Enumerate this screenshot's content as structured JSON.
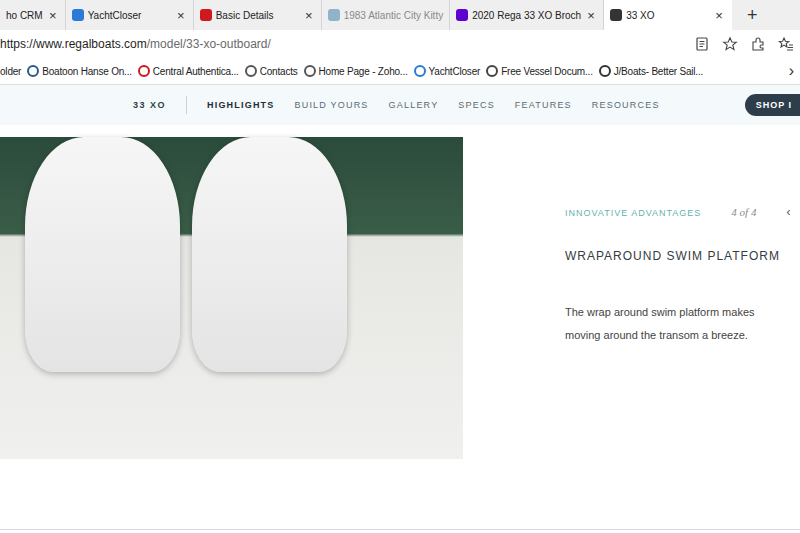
{
  "browser": {
    "tabs": [
      {
        "label": "ho CRM",
        "selected": false,
        "closable": true,
        "muted": false
      },
      {
        "label": "YachtCloser",
        "selected": false,
        "closable": true,
        "muted": false,
        "color": "#2b7bd6"
      },
      {
        "label": "Basic Details",
        "selected": false,
        "closable": true,
        "muted": false,
        "color": "#d0191e"
      },
      {
        "label": "1983 Atlantic City Kitty",
        "selected": false,
        "closable": false,
        "muted": true,
        "color": "#8fb3c9"
      },
      {
        "label": "2020 Rega 33 XO Broch",
        "selected": false,
        "closable": true,
        "muted": false,
        "color": "#5f01d1"
      },
      {
        "label": "33 XO",
        "selected": true,
        "closable": true,
        "muted": false,
        "color": "#333333"
      }
    ],
    "close": "×",
    "new_tab": "+",
    "address_host": "https://www.regalboats.com",
    "address_path": "/model/33-xo-outboard/",
    "bookmarks": [
      {
        "label": "older"
      },
      {
        "label": "Boatoon Hanse On...",
        "color": "#2a5c8a"
      },
      {
        "label": "Central Authentica...",
        "color": "#d0191e"
      },
      {
        "label": "Contacts",
        "color": "#555555"
      },
      {
        "label": "Home Page - Zoho...",
        "color": "#555555"
      },
      {
        "label": "YachtCloser",
        "color": "#2b7bd6"
      },
      {
        "label": "Free Vessel Docum...",
        "color": "#444444"
      },
      {
        "label": "J/Boats- Better Sail...",
        "color": "#333333"
      }
    ],
    "bookmarks_more": "›"
  },
  "site_nav": {
    "model": "33 XO",
    "items": [
      {
        "label": "HIGHLIGHTS",
        "selected": true
      },
      {
        "label": "BUILD YOURS",
        "selected": false
      },
      {
        "label": "GALLERY",
        "selected": false
      },
      {
        "label": "SPECS",
        "selected": false
      },
      {
        "label": "FEATURES",
        "selected": false
      },
      {
        "label": "RESOURCES",
        "selected": false
      }
    ],
    "shop_button": "SHOP I"
  },
  "feature": {
    "eyebrow": "INNOVATIVE ADVANTAGES",
    "counter": "4 of 4",
    "prev": "‹",
    "title": "WRAPAROUND SWIM PLATFORM",
    "body": "The wrap around swim platform makes moving around the transom a breeze."
  }
}
